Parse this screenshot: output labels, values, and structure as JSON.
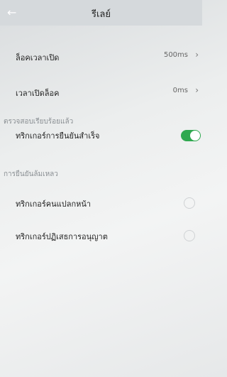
{
  "header": {
    "title": "รีเลย์",
    "back_icon": "arrow-left-icon"
  },
  "settings": {
    "lock_time": {
      "label": "ล็อคเวลาเปิด",
      "value": "500ms"
    },
    "unlock_time": {
      "label": "เวลาเปิดล็อค",
      "value": "0ms"
    }
  },
  "section_success": {
    "title": "ตรวจสอบเรียบร้อยแล้ว",
    "trigger_success": {
      "label": "ทริกเกอร์การยืนยันสำเร็จ",
      "enabled": true
    }
  },
  "section_failure": {
    "title": "การยืนยันล้มเหลว",
    "trigger_stranger": {
      "label": "ทริกเกอร์คนแปลกหน้า"
    },
    "trigger_denied": {
      "label": "ทริกเกอร์ปฏิเสธการอนุญาต"
    }
  },
  "colors": {
    "toggle_on": "#2fa84f"
  }
}
